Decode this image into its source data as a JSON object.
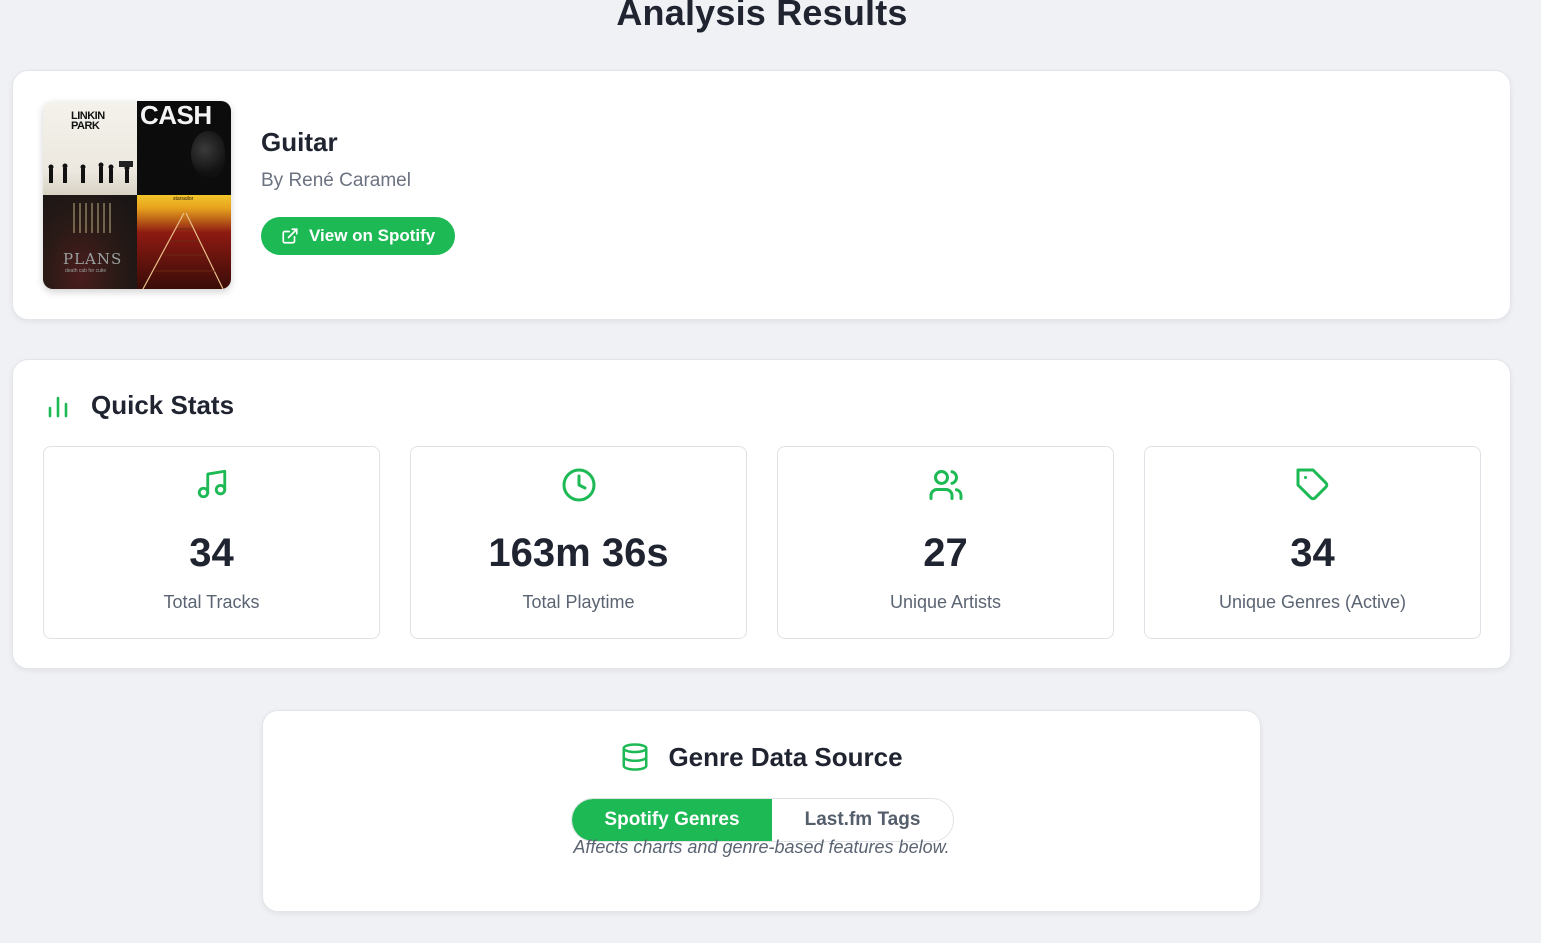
{
  "page": {
    "title": "Analysis Results"
  },
  "playlist": {
    "name": "Guitar",
    "owner": "By René Caramel",
    "spotify_button": "View on Spotify",
    "cover": {
      "tile1_text": "LINKIN PARK",
      "tile2_text": "CASH",
      "tile3_text": "PLANS",
      "tile3_subtext": "death cab for cutie",
      "tile4_text": "starsailor"
    }
  },
  "quick_stats": {
    "title": "Quick Stats",
    "items": [
      {
        "icon": "music-note-icon",
        "value": "34",
        "label": "Total Tracks"
      },
      {
        "icon": "clock-icon",
        "value": "163m 36s",
        "label": "Total Playtime"
      },
      {
        "icon": "users-icon",
        "value": "27",
        "label": "Unique Artists"
      },
      {
        "icon": "tag-icon",
        "value": "34",
        "label": "Unique Genres (Active)"
      }
    ]
  },
  "genre_source": {
    "title": "Genre Data Source",
    "options": [
      "Spotify Genres",
      "Last.fm Tags"
    ],
    "selected": "Spotify Genres",
    "note": "Affects charts and genre-based features below."
  },
  "colors": {
    "accent": "#1db954",
    "background": "#f0f1f5",
    "text": "#1f2430",
    "muted": "#6b7280"
  }
}
